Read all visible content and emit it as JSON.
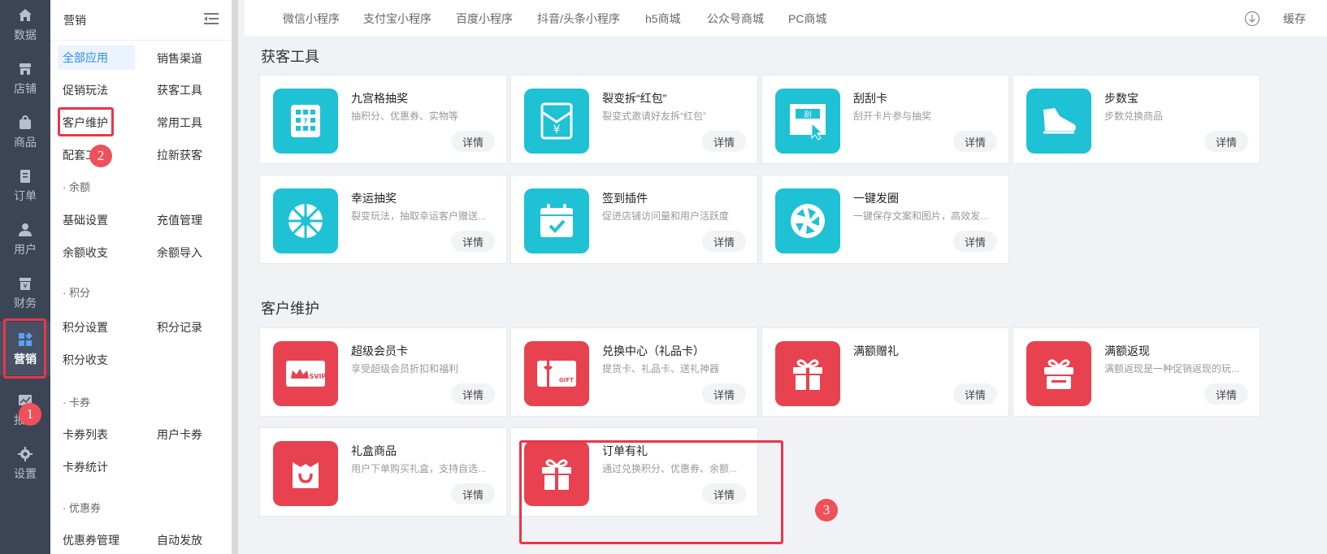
{
  "rail": {
    "items": [
      {
        "label": "数据",
        "icon": "home-icon"
      },
      {
        "label": "店铺",
        "icon": "store-icon"
      },
      {
        "label": "商品",
        "icon": "bag-icon"
      },
      {
        "label": "订单",
        "icon": "order-icon"
      },
      {
        "label": "用户",
        "icon": "user-icon"
      },
      {
        "label": "财务",
        "icon": "finance-icon"
      },
      {
        "label": "营销",
        "icon": "marketing-icon"
      },
      {
        "label": "报表",
        "icon": "report-icon"
      },
      {
        "label": "设置",
        "icon": "gear-icon"
      }
    ]
  },
  "menu": {
    "title": "营销",
    "items": {
      "all_apps": "全部应用",
      "sales_channel": "销售渠道",
      "promo": "促销玩法",
      "acquire": "获客工具",
      "customer_care": "客户维护",
      "common_tools": "常用工具",
      "support_prefix": "配套工",
      "new_pack": "拉新获客",
      "sec_balance": "· 余额",
      "basic_settings": "基础设置",
      "recharge": "充值管理",
      "balance_flow": "余额收支",
      "balance_import": "余额导入",
      "sec_points": "· 积分",
      "points_settings": "积分设置",
      "points_record": "积分记录",
      "points_flow": "积分收支",
      "sec_coupon_card": "· 卡券",
      "card_list": "卡券列表",
      "user_cards": "用户卡券",
      "card_stats": "卡券统计",
      "sec_coupon": "· 优惠券",
      "coupon_manage": "优惠券管理",
      "auto_issue": "自动发放"
    }
  },
  "tabs": [
    "微信小程序",
    "支付宝小程序",
    "百度小程序",
    "抖音/头条小程序",
    "h5商城",
    "公众号商城",
    "PC商城"
  ],
  "topbar": {
    "cache": "缓存"
  },
  "sections": {
    "acquire_title": "获客工具",
    "care_title": "客户维护"
  },
  "acquire_cards": [
    {
      "title": "九宫格抽奖",
      "desc": "抽积分、优惠券、实物等",
      "btn": "详情"
    },
    {
      "title": "裂变拆“红包”",
      "desc": "裂变式邀请好友拆“红包”",
      "btn": "详情"
    },
    {
      "title": "刮刮卡",
      "desc": "刮开卡片参与抽奖",
      "btn": "详情"
    },
    {
      "title": "步数宝",
      "desc": "步数兑换商品",
      "btn": "详情"
    },
    {
      "title": "幸运抽奖",
      "desc": "裂变玩法，抽取幸运客户赠送...",
      "btn": "详情"
    },
    {
      "title": "签到插件",
      "desc": "促进店铺访问量和用户活跃度",
      "btn": "详情"
    },
    {
      "title": "一键发圈",
      "desc": "一键保存文案和图片，高效发...",
      "btn": "详情"
    }
  ],
  "care_cards": [
    {
      "title": "超级会员卡",
      "desc": "享受超级会员折扣和福利",
      "btn": "详情"
    },
    {
      "title": "兑换中心（礼品卡）",
      "desc": "提货卡、礼品卡、送礼神器",
      "btn": "详情"
    },
    {
      "title": "满额赠礼",
      "desc": "",
      "btn": "详情"
    },
    {
      "title": "满额返现",
      "desc": "满额返现是一种促销返现的玩...",
      "btn": "详情"
    },
    {
      "title": "礼盒商品",
      "desc": "用户下单购买礼盒，支持自选...",
      "btn": "详情"
    },
    {
      "title": "订单有礼",
      "desc": "通过兑换积分、优惠券、余额...",
      "btn": "详情"
    }
  ],
  "annotations": {
    "step1": "1",
    "step2": "2",
    "step3": "3"
  },
  "icon_text": {
    "scratch": "刮",
    "svip": "SVIP",
    "gift": "GIFT",
    "yen": "¥"
  },
  "colors": {
    "accent": "#2d8cf0",
    "cyan": "#1fc1d4",
    "red": "#e8414f",
    "annotation": "#e8364a"
  }
}
